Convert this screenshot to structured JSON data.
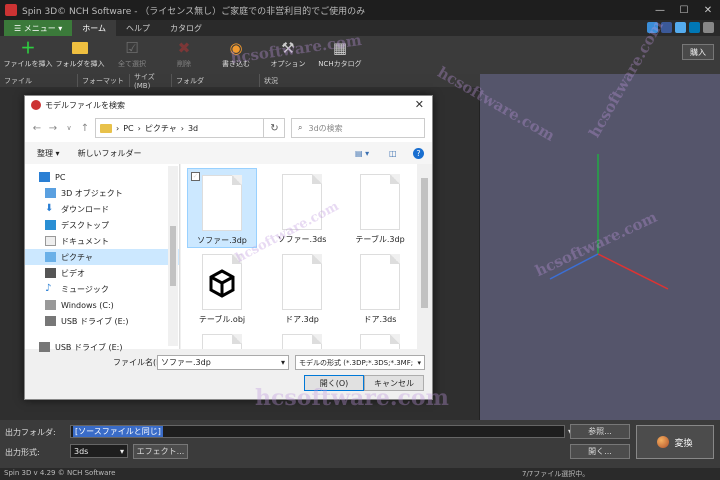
{
  "window": {
    "title": "Spin 3D© NCH Software - （ライセンス無し）ご家庭での非営利目的でご使用のみ",
    "controls": [
      "—",
      "☐",
      "✕"
    ]
  },
  "menubar": {
    "menu_label": "☰ メニュー ▾",
    "tabs": [
      "ホーム",
      "ヘルプ",
      "カタログ"
    ]
  },
  "toolbar": {
    "buttons": [
      {
        "label": "ファイルを挿入",
        "icon": "＋",
        "color": "#2ecc40",
        "enabled": true
      },
      {
        "label": "フォルダを挿入",
        "icon": "📁",
        "color": "#f0c040",
        "enabled": true
      },
      {
        "label": "全て選択",
        "icon": "☑",
        "color": "#aaaaaa",
        "enabled": false
      },
      {
        "label": "削除",
        "icon": "✖",
        "color": "#cc3333",
        "enabled": false
      },
      {
        "label": "書き込む",
        "icon": "◉",
        "color": "#f09a30",
        "enabled": true
      },
      {
        "label": "オプション",
        "icon": "🔧",
        "color": "#cccccc",
        "enabled": true
      },
      {
        "label": "NCHカタログ",
        "icon": "▦",
        "color": "#cccccc",
        "enabled": true
      }
    ],
    "buy_label": "購入"
  },
  "filelist": {
    "columns": [
      "ファイル",
      "フォーマット",
      "サイズ(MB)",
      "フォルダ",
      "状況"
    ]
  },
  "dialog": {
    "title": "モデルファイルを検索",
    "breadcrumb": [
      "PC",
      "ピクチャ",
      "3d"
    ],
    "search_placeholder": "3dの検索",
    "commands": {
      "organize": "整理 ▾",
      "new_folder": "新しいフォルダー"
    },
    "nav_items": [
      {
        "label": "PC",
        "icon": "pc",
        "selected": false,
        "indent": 0
      },
      {
        "label": "3D オブジェクト",
        "icon": "cube",
        "selected": false,
        "indent": 1
      },
      {
        "label": "ダウンロード",
        "icon": "download",
        "selected": false,
        "indent": 1
      },
      {
        "label": "デスクトップ",
        "icon": "desktop",
        "selected": false,
        "indent": 1
      },
      {
        "label": "ドキュメント",
        "icon": "document",
        "selected": false,
        "indent": 1
      },
      {
        "label": "ピクチャ",
        "icon": "picture",
        "selected": true,
        "indent": 1
      },
      {
        "label": "ビデオ",
        "icon": "video",
        "selected": false,
        "indent": 1
      },
      {
        "label": "ミュージック",
        "icon": "music",
        "selected": false,
        "indent": 1
      },
      {
        "label": "Windows (C:)",
        "icon": "drive",
        "selected": false,
        "indent": 1
      },
      {
        "label": "USB ドライブ (E:)",
        "icon": "usb",
        "selected": false,
        "indent": 1
      },
      {
        "label": "USB ドライブ (E:)",
        "icon": "usb",
        "selected": false,
        "indent": 0
      }
    ],
    "files": [
      {
        "name": "ソファー.3dp",
        "selected": true,
        "kind": "doc"
      },
      {
        "name": "ソファー.3ds",
        "selected": false,
        "kind": "doc"
      },
      {
        "name": "テーブル.3dp",
        "selected": false,
        "kind": "doc"
      },
      {
        "name": "テーブル.obj",
        "selected": false,
        "kind": "obj"
      },
      {
        "name": "ドア.3dp",
        "selected": false,
        "kind": "doc"
      },
      {
        "name": "ドア.3ds",
        "selected": false,
        "kind": "doc"
      }
    ],
    "filename_label": "ファイル名(N):",
    "filename_value": "ソファー.3dp",
    "filter_value": "モデルの形式 (*.3DP;*.3DS;*.3MF;",
    "open_label": "開く(O)",
    "cancel_label": "キャンセル"
  },
  "bottom": {
    "outfolder_label": "出力フォルダ:",
    "outfolder_value": "[ソースファイルと同じ]",
    "browse_label": "参照...",
    "open_label": "開く...",
    "format_label": "出力形式:",
    "format_value": "3ds",
    "effect_label": "エフェクト...",
    "convert_label": "変換"
  },
  "status": {
    "left": "Spin 3D v 4.29 © NCH Software",
    "right": "7/7ファイル選択中。"
  },
  "watermarks": [
    "hcsoftware.com",
    "hcsoftware.com",
    "hcsoftware.com",
    "hcsoftware.com",
    "hcsoftware.com",
    "hcsoftware.com"
  ]
}
